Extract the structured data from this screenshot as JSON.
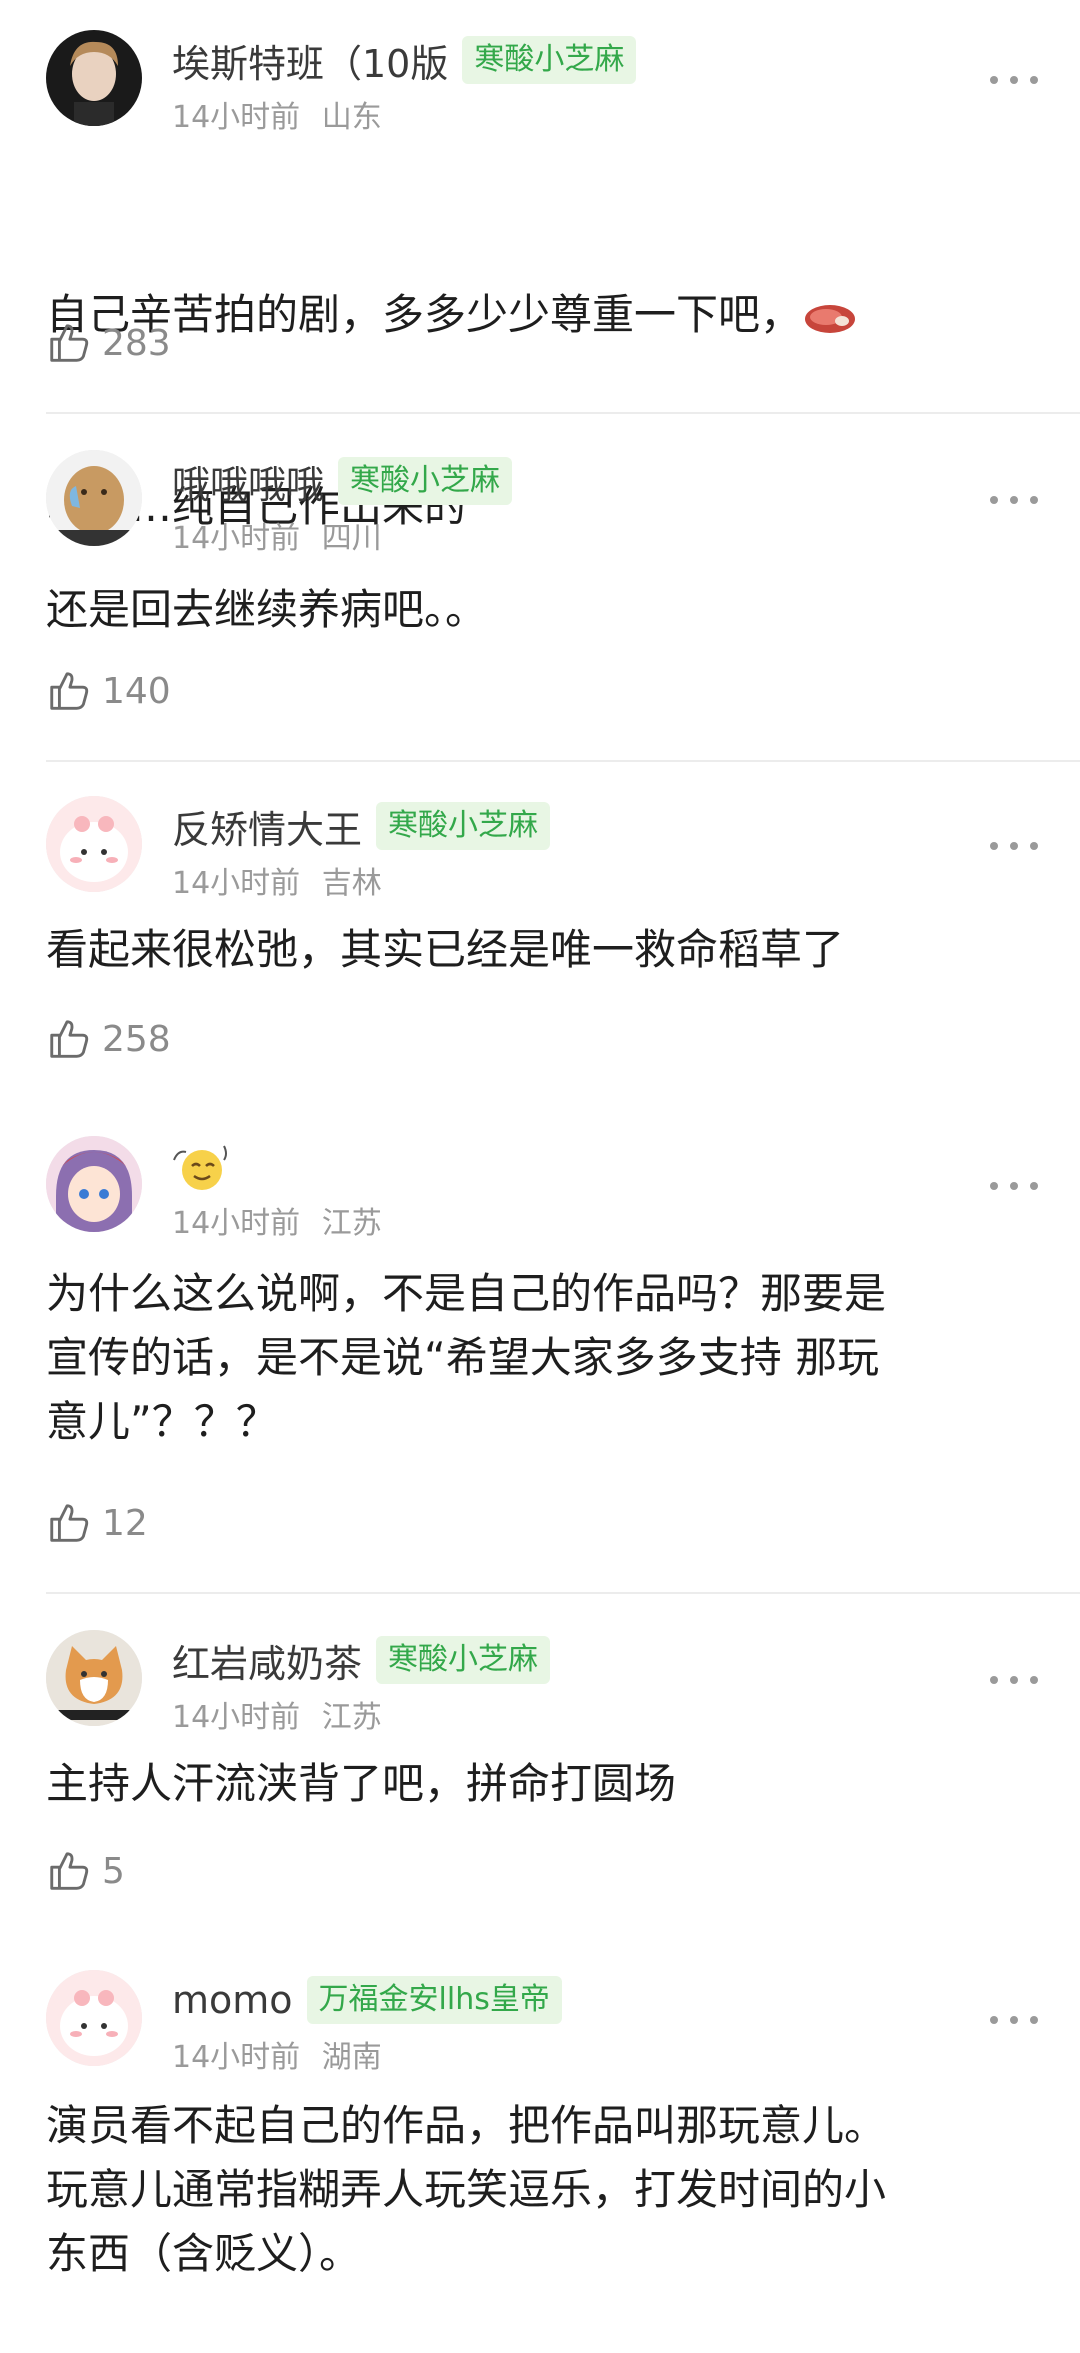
{
  "comments": [
    {
      "username": "埃斯特班（10版",
      "badge": "寒酸小芝麻",
      "time": "14小时前",
      "location": "山东",
      "text_line1": "自己辛苦拍的剧，多多少少尊重一下吧，",
      "text_line2": "啊……纯自己作出来的",
      "emoji_icon": "steak-emoji-icon",
      "likes": "283",
      "avatar_icon": "portrait-avatar"
    },
    {
      "username": "哦哦哦哦",
      "badge": "寒酸小芝麻",
      "time": "14小时前",
      "location": "四川",
      "text": "还是回去继续养病吧。。",
      "likes": "140",
      "avatar_icon": "potato-cartoon-avatar"
    },
    {
      "username": "反矫情大王",
      "badge": "寒酸小芝麻",
      "time": "14小时前",
      "location": "吉林",
      "text": "看起来很松弛，其实已经是唯一救命稻草了",
      "likes": "258",
      "avatar_icon": "pink-cartoon-avatar"
    },
    {
      "username_icon": "sweat-smile-emoji-icon",
      "time": "14小时前",
      "location": "江苏",
      "text": "为什么这么说啊，不是自己的作品吗？那要是\n宣传的话，是不是说“希望大家多多支持 那玩\n意儿”？？？",
      "likes": "12",
      "avatar_icon": "anime-girl-avatar"
    },
    {
      "username": "红岩咸奶茶",
      "badge": "寒酸小芝麻",
      "time": "14小时前",
      "location": "江苏",
      "text": "主持人汗流浃背了吧，拼命打圆场",
      "likes": "5",
      "avatar_icon": "cat-avatar"
    },
    {
      "username": "momo",
      "badge": "万福金安llhs皇帝",
      "time": "14小时前",
      "location": "湖南",
      "text": "演员看不起自己的作品，把作品叫那玩意儿。\n玩意儿通常指糊弄人玩笑逗乐，打发时间的小\n东西（含贬义）。",
      "avatar_icon": "pink-cartoon-avatar"
    }
  ],
  "colors": {
    "badge_bg": "#e8f6e4",
    "badge_text": "#33a84a",
    "meta_text": "#9a9a9a"
  }
}
